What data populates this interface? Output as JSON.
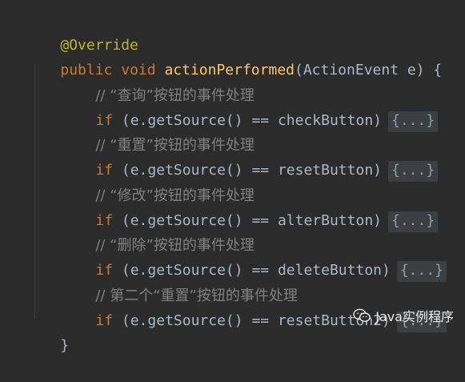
{
  "code": {
    "annotation": "@Override",
    "signature": {
      "modifier": "public",
      "return_type": "void",
      "method_name": "actionPerformed",
      "params": "(ActionEvent e) {"
    },
    "lines": [
      {
        "comment": "// “查询”按钮的事件处理"
      },
      {
        "keyword": "if",
        "condition": " (e.getSource() == checkButton)",
        "fold": "{...}"
      },
      {
        "comment": "// “重置”按钮的事件处理"
      },
      {
        "keyword": "if",
        "condition": " (e.getSource() == resetButton)",
        "fold": "{...}"
      },
      {
        "comment": "// “修改”按钮的事件处理"
      },
      {
        "keyword": "if",
        "condition": " (e.getSource() == alterButton)",
        "fold": "{...}"
      },
      {
        "comment": "// “删除”按钮的事件处理"
      },
      {
        "keyword": "if",
        "condition": " (e.getSource() == deleteButton)",
        "fold": "{...}"
      },
      {
        "comment": "// 第二个“重置”按钮的事件处理"
      },
      {
        "keyword": "if",
        "condition": " (e.getSource() == resetButton2)",
        "fold": "{...}"
      }
    ],
    "closing_brace": "}"
  },
  "watermark": {
    "text": "Java实例程序",
    "icon": "wechat-icon"
  },
  "colors": {
    "background": "#2b2b2b",
    "annotation": "#bbb529",
    "keyword": "#cc7832",
    "method": "#ffc66d",
    "comment": "#808080",
    "text": "#a9b7c6",
    "fold_bg": "#3b3f41"
  }
}
